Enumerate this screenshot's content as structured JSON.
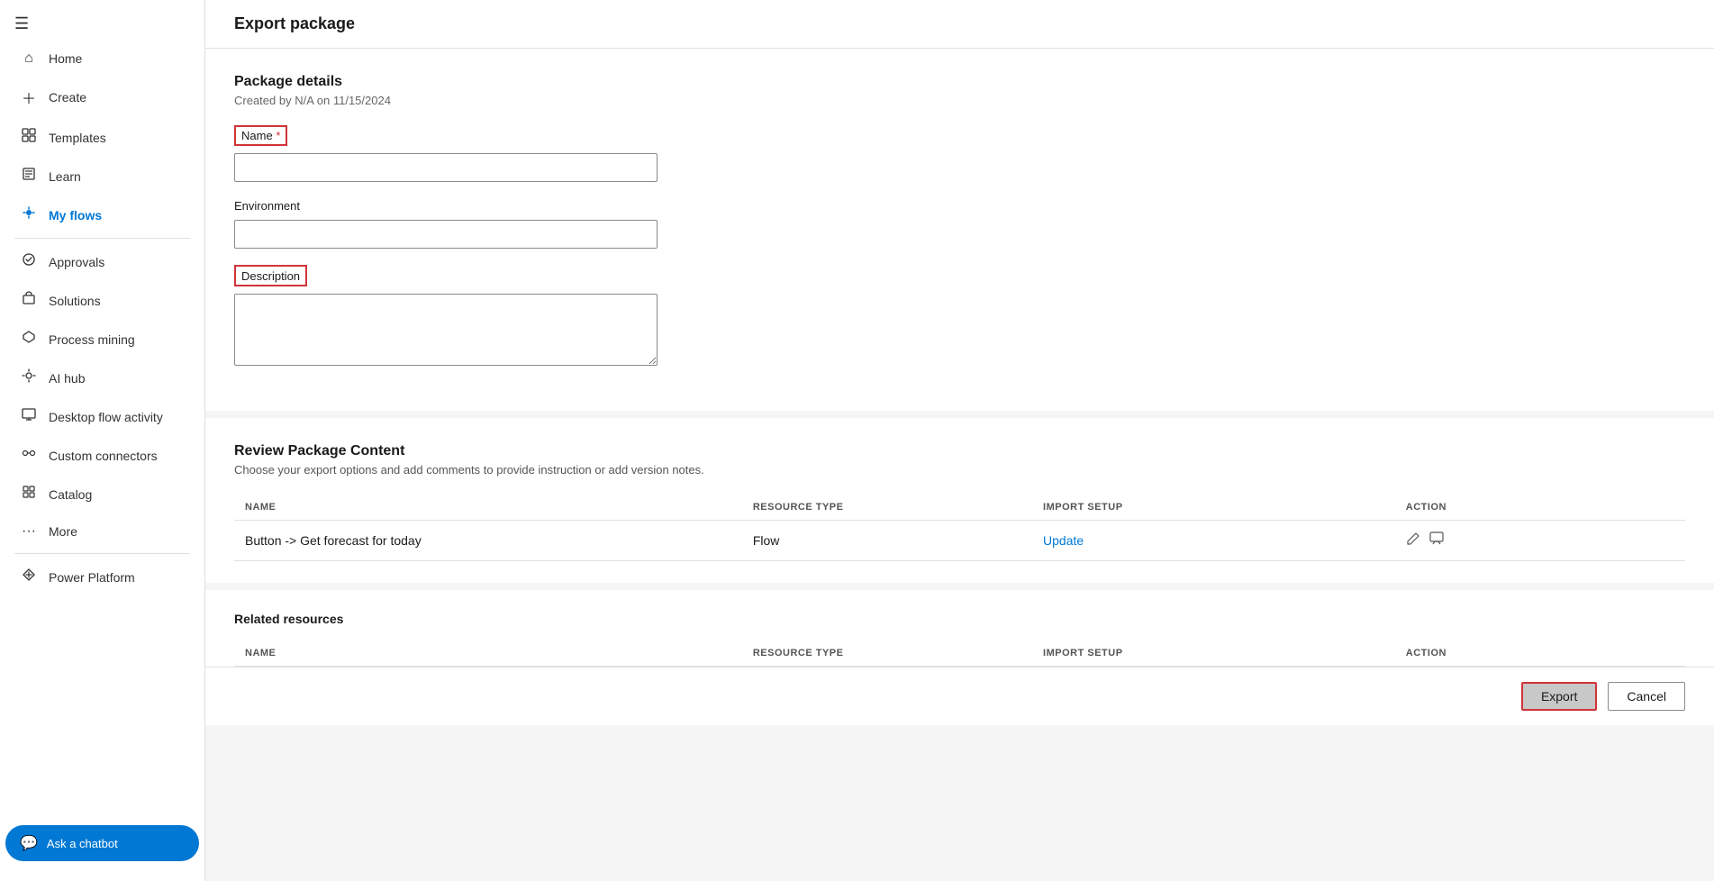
{
  "sidebar": {
    "hamburger_icon": "☰",
    "items": [
      {
        "id": "home",
        "label": "Home",
        "icon": "⌂",
        "active": false
      },
      {
        "id": "create",
        "label": "Create",
        "icon": "+",
        "active": false
      },
      {
        "id": "templates",
        "label": "Templates",
        "icon": "📄",
        "active": false
      },
      {
        "id": "learn",
        "label": "Learn",
        "icon": "📖",
        "active": false
      },
      {
        "id": "my-flows",
        "label": "My flows",
        "icon": "💧",
        "active": true
      },
      {
        "id": "approvals",
        "label": "Approvals",
        "icon": "✅",
        "active": false
      },
      {
        "id": "solutions",
        "label": "Solutions",
        "icon": "📦",
        "active": false
      },
      {
        "id": "process-mining",
        "label": "Process mining",
        "icon": "⬡",
        "active": false
      },
      {
        "id": "ai-hub",
        "label": "AI hub",
        "icon": "🤖",
        "active": false
      },
      {
        "id": "desktop-flow-activity",
        "label": "Desktop flow activity",
        "icon": "🖥",
        "active": false
      },
      {
        "id": "custom-connectors",
        "label": "Custom connectors",
        "icon": "🔌",
        "active": false
      },
      {
        "id": "catalog",
        "label": "Catalog",
        "icon": "🏷",
        "active": false
      },
      {
        "id": "more",
        "label": "More",
        "icon": "...",
        "active": false
      },
      {
        "id": "power-platform",
        "label": "Power Platform",
        "icon": "⚡",
        "active": false
      }
    ],
    "chatbot": {
      "label": "Ask a chatbot",
      "icon": "💬"
    }
  },
  "page": {
    "title": "Export package"
  },
  "package_details": {
    "section_title": "Package details",
    "subtitle": "Created by N/A on 11/15/2024",
    "name_label": "Name",
    "required_star": "*",
    "name_placeholder": "",
    "environment_label": "Environment",
    "environment_placeholder": "",
    "description_label": "Description",
    "description_placeholder": ""
  },
  "review_package": {
    "section_title": "Review Package Content",
    "subtitle": "Choose your export options and add comments to provide instruction or add version notes.",
    "columns": {
      "name": "NAME",
      "resource_type": "RESOURCE TYPE",
      "import_setup": "IMPORT SETUP",
      "action": "ACTION"
    },
    "rows": [
      {
        "name": "Button -> Get forecast for today",
        "resource_type": "Flow",
        "import_setup": "Update",
        "import_setup_is_link": true
      }
    ]
  },
  "related_resources": {
    "section_title": "Related resources",
    "columns": {
      "name": "NAME",
      "resource_type": "RESOURCE TYPE",
      "import_setup": "IMPORT SETUP",
      "action": "ACTION"
    },
    "rows": []
  },
  "footer": {
    "export_label": "Export",
    "cancel_label": "Cancel"
  }
}
